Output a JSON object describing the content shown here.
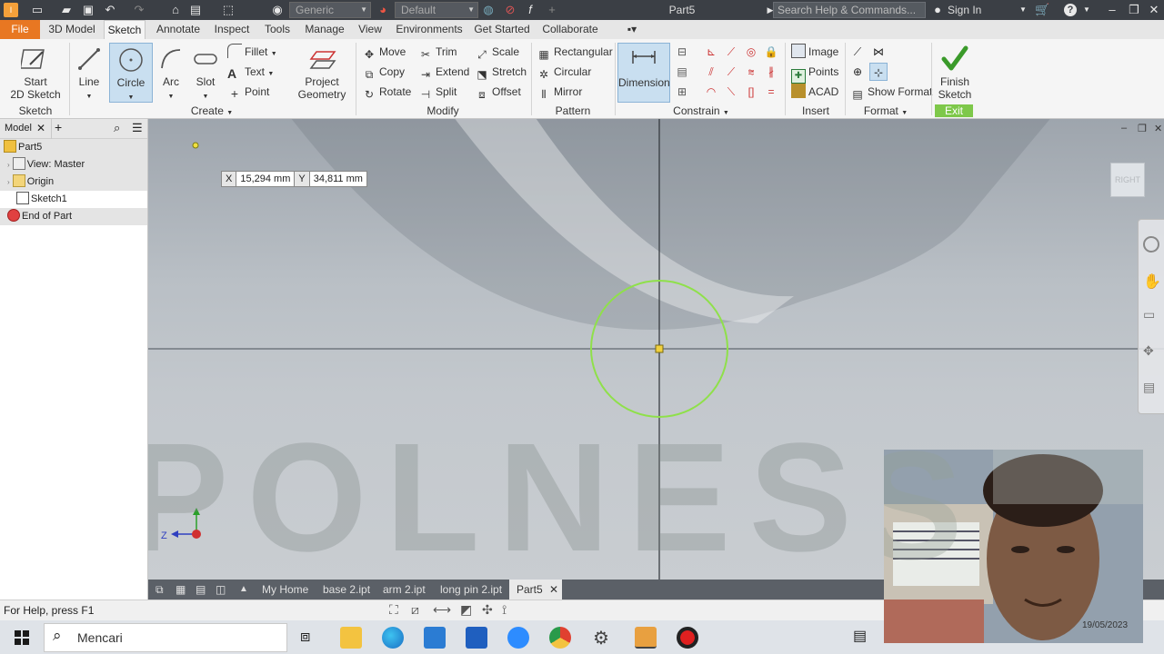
{
  "titlebar": {
    "style_dropdown": "Generic",
    "appearance_dropdown": "Default",
    "doc_title": "Part5",
    "search_placeholder": "Search Help & Commands...",
    "sign_in": "Sign In"
  },
  "tabs": [
    "File",
    "3D Model",
    "Sketch",
    "Annotate",
    "Inspect",
    "Tools",
    "Manage",
    "View",
    "Environments",
    "Get Started",
    "Collaborate"
  ],
  "ribbon": {
    "sketch_panel": {
      "start_2d_sketch": "Start\n2D Sketch",
      "label": "Sketch"
    },
    "create_panel": {
      "line": "Line",
      "circle": "Circle",
      "arc": "Arc",
      "slot": "Slot",
      "fillet": "Fillet",
      "text": "Text",
      "point": "Point",
      "project_geometry": "Project\nGeometry",
      "label": "Create"
    },
    "modify_panel": {
      "move": "Move",
      "copy": "Copy",
      "rotate": "Rotate",
      "trim": "Trim",
      "extend": "Extend",
      "split": "Split",
      "scale": "Scale",
      "stretch": "Stretch",
      "offset": "Offset",
      "label": "Modify"
    },
    "pattern_panel": {
      "rectangular": "Rectangular",
      "circular": "Circular",
      "mirror": "Mirror",
      "label": "Pattern"
    },
    "constrain_panel": {
      "dimension": "Dimension",
      "label": "Constrain"
    },
    "insert_panel": {
      "image": "Image",
      "points": "Points",
      "acad": "ACAD",
      "label": "Insert"
    },
    "format_panel": {
      "show_format": "Show Format",
      "label": "Format"
    },
    "exit_panel": {
      "finish_sketch": "Finish\nSketch",
      "label": "Exit"
    }
  },
  "browser": {
    "tab_label": "Model",
    "tree": [
      "Part5",
      "View: Master",
      "Origin",
      "Sketch1",
      "End of Part"
    ]
  },
  "canvas": {
    "coord_x_label": "X",
    "coord_x_value": "15,294 mm",
    "coord_y_label": "Y",
    "coord_y_value": "34,811 mm",
    "viewcube_face": "RIGHT",
    "watermark_text": "POLNES",
    "axis_z": "Z",
    "circle_color": "#8fe04a",
    "accent_color": "#e87722"
  },
  "doc_tabs": [
    "My Home",
    "base 2.ipt",
    "arm 2.ipt",
    "long pin 2.ipt",
    "Part5"
  ],
  "statusbar": {
    "help_text": "For Help, press F1"
  },
  "taskbar": {
    "search_text": "Mencari",
    "date_partial": "19/05/2023"
  }
}
